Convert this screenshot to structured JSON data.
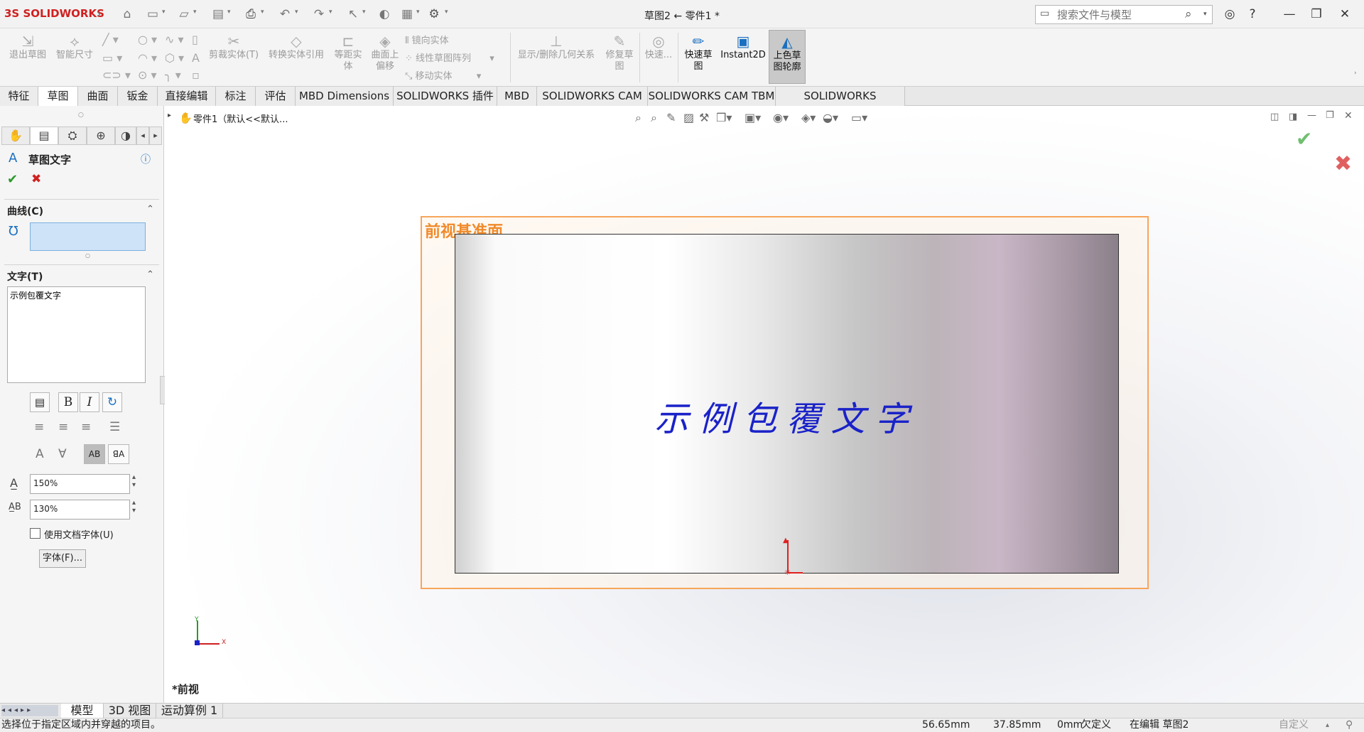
{
  "app": {
    "logo": "3S SOLIDWORKS",
    "title": "草图2 ← 零件1 *"
  },
  "search": {
    "prefix": "",
    "placeholder": "搜索文件与模型"
  },
  "ribbon": {
    "exit_sketch": "退出草图",
    "smart_dim": "智能尺寸",
    "trim": "剪裁实体(T)",
    "convert": "转换实体引用",
    "offset": "等距实体",
    "offset_surface": "曲面上偏移",
    "mirror": "镜向实体",
    "linear_pattern": "线性草图阵列",
    "move": "移动实体",
    "show_relations": "显示/删除几何关系",
    "repair": "修复草图",
    "quick_snaps": "快速...",
    "rapid_sketch": "快速草图",
    "instant2d": "Instant2D",
    "shaded_sketch": "上色草图轮廓"
  },
  "tabs": [
    "特征",
    "草图",
    "曲面",
    "钣金",
    "直接编辑",
    "标注",
    "评估",
    "MBD Dimensions",
    "SOLIDWORKS 插件",
    "MBD",
    "SOLIDWORKS CAM",
    "SOLIDWORKS CAM TBM",
    "SOLIDWORKS Inspection"
  ],
  "feature_tree": {
    "root": "零件1（默认<<默认..."
  },
  "panel": {
    "title": "草图文字",
    "curves_label": "曲线(C)",
    "text_label": "文字(T)",
    "text_value": "示例包覆文字",
    "width_factor": "150%",
    "spacing": "130%",
    "use_doc_font": "使用文档字体(U)",
    "font_button": "字体(F)..."
  },
  "viewport": {
    "plane_label": "前视基准面",
    "wrap_text": "示例包覆文字",
    "view_name": "*前视",
    "axis_y": "Y",
    "axis_x": "X"
  },
  "bottom_tabs": [
    "模型",
    "3D 视图",
    "运动算例 1"
  ],
  "status": {
    "message": "选择位于指定区域内并穿越的项目。",
    "x": "56.65mm",
    "y": "37.85mm",
    "z": "0mm",
    "state": "欠定义",
    "mode": "在编辑 草图2",
    "custom": "自定义"
  },
  "colors": {
    "accent": "#1a6fc0",
    "plane_border": "#f7a55a",
    "plane_label": "#f08a2a",
    "wrap_text": "#1a22c8",
    "origin": "#e02020"
  }
}
